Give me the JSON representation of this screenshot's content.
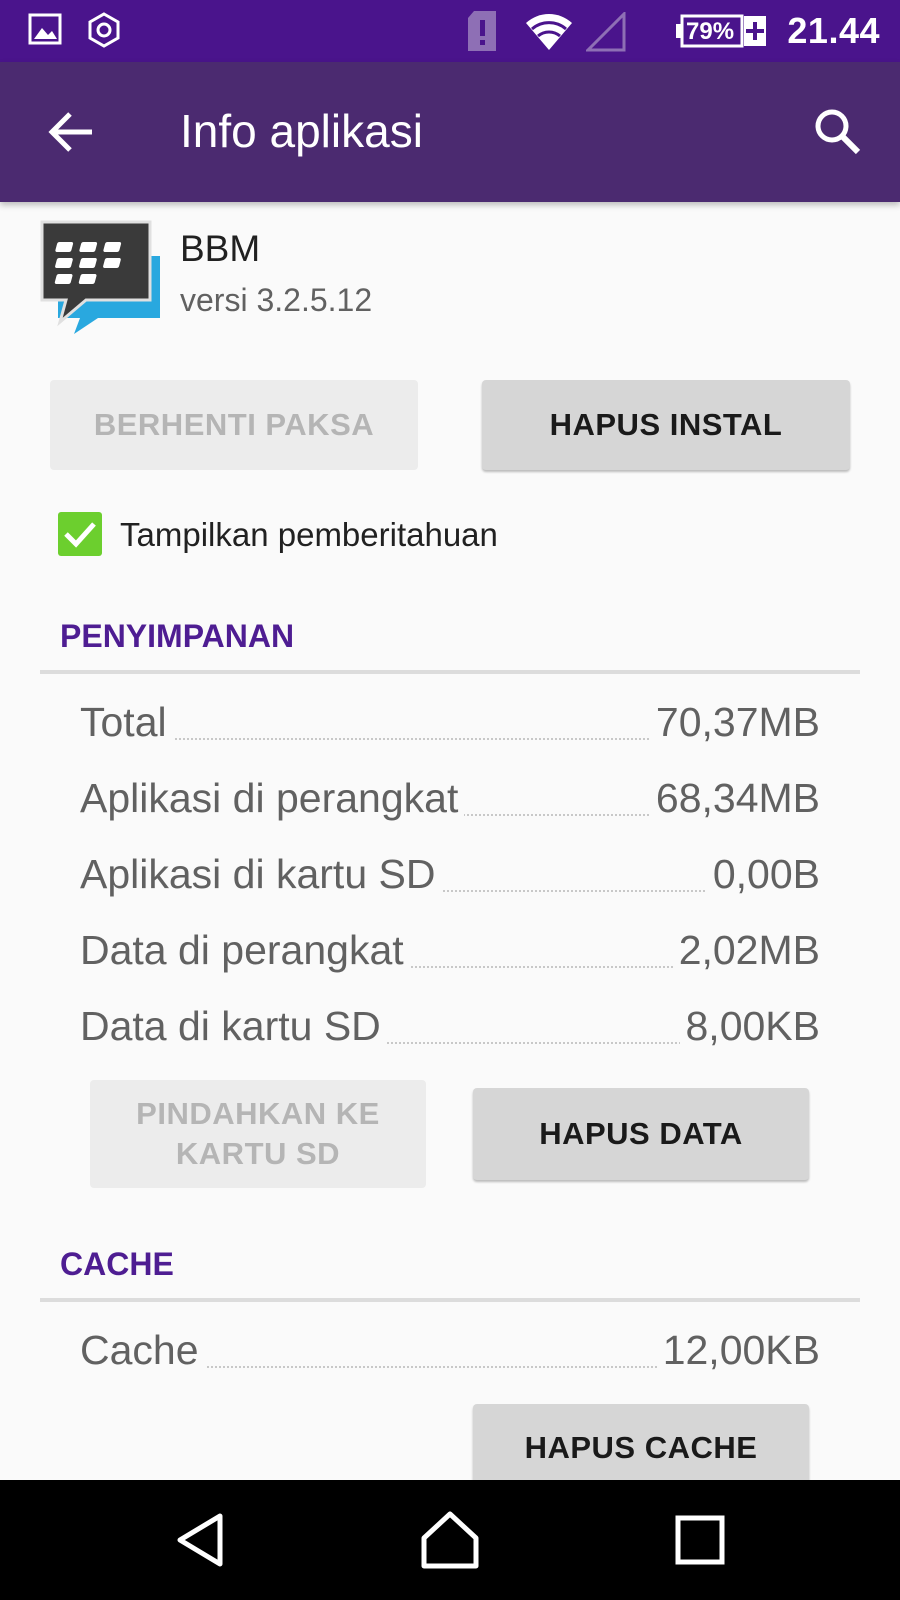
{
  "status_bar": {
    "time": "21.44",
    "battery_percent": "79%",
    "icons": [
      "image-icon",
      "settings-hex-icon",
      "sim-alert-icon",
      "wifi-icon",
      "signal-icon",
      "battery-icon"
    ]
  },
  "app_bar": {
    "title": "Info aplikasi",
    "back_icon": "arrow-back-icon",
    "search_icon": "search-icon",
    "color": "#4b2a70"
  },
  "app": {
    "name": "BBM",
    "version": "versi 3.2.5.12",
    "icon": "bbm-logo-icon"
  },
  "actions": {
    "force_stop": "BERHENTI PAKSA",
    "uninstall": "HAPUS INSTAL"
  },
  "notifications": {
    "label": "Tampilkan pemberitahuan",
    "checked": true
  },
  "storage": {
    "header": "PENYIMPANAN",
    "rows": [
      {
        "label": "Total",
        "value": "70,37MB"
      },
      {
        "label": "Aplikasi di perangkat",
        "value": "68,34MB"
      },
      {
        "label": "Aplikasi di kartu SD",
        "value": "0,00B"
      },
      {
        "label": "Data di perangkat",
        "value": "2,02MB"
      },
      {
        "label": "Data di kartu SD",
        "value": "8,00KB"
      }
    ],
    "move_button": {
      "line1": "PINDAHKAN KE",
      "line2": "KARTU SD"
    },
    "clear_data_button": "HAPUS DATA"
  },
  "cache": {
    "header": "CACHE",
    "row": {
      "label": "Cache",
      "value": "12,00KB"
    },
    "clear_cache_button": "HAPUS CACHE"
  },
  "nav_bar": {
    "icons": [
      "back-triangle-icon",
      "home-icon",
      "recents-icon"
    ]
  },
  "colors": {
    "status_bar": "#4a148c",
    "accent": "#4e1d92",
    "checkbox": "#6ccf2e"
  }
}
